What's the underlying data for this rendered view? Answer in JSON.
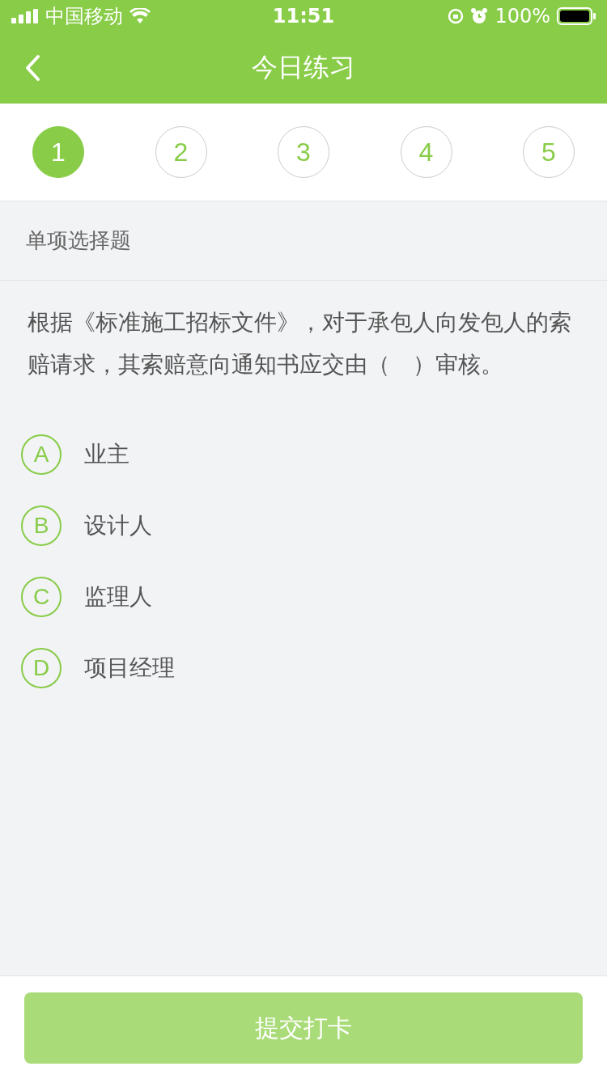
{
  "status_bar": {
    "carrier": "中国移动",
    "time": "11:51",
    "battery": "100%"
  },
  "nav": {
    "title": "今日练习"
  },
  "steps": [
    {
      "label": "1",
      "selected": true
    },
    {
      "label": "2",
      "selected": false
    },
    {
      "label": "3",
      "selected": false
    },
    {
      "label": "4",
      "selected": false
    },
    {
      "label": "5",
      "selected": false
    }
  ],
  "question": {
    "type": "单项选择题",
    "text": "根据《标准施工招标文件》，对于承包人向发包人的索赔请求，其索赔意向通知书应交由（　）审核。"
  },
  "options": [
    {
      "letter": "A",
      "text": "业主",
      "selected": false
    },
    {
      "letter": "B",
      "text": "设计人",
      "selected": false
    },
    {
      "letter": "C",
      "text": "监理人",
      "selected": false
    },
    {
      "letter": "D",
      "text": "项目经理",
      "selected": false
    }
  ],
  "submit": {
    "label": "提交打卡",
    "disabled": true
  }
}
